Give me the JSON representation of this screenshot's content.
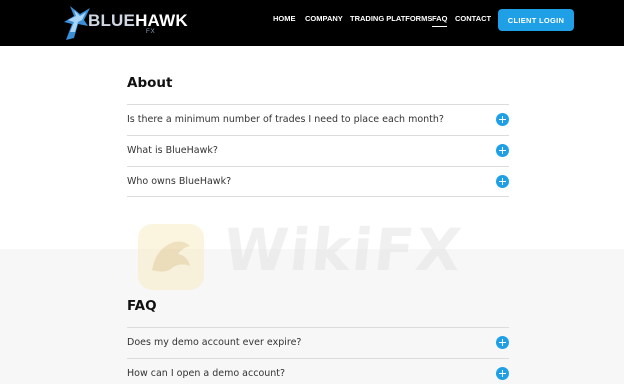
{
  "header": {
    "logo": {
      "word1": "BLUE",
      "word2": "HAWK",
      "suffix": "FX",
      "icon": "hawk-logo-icon"
    },
    "nav": [
      {
        "label": "HOME",
        "active": false
      },
      {
        "label": "COMPANY",
        "active": false
      },
      {
        "label": "TRADING PLATFORMS",
        "active": false
      },
      {
        "label": "FAQ",
        "active": true
      },
      {
        "label": "CONTACT",
        "active": false
      }
    ],
    "login_label": "CLIENT LOGIN"
  },
  "about": {
    "title": "About",
    "items": [
      "Is there a minimum number of trades I need to place each month?",
      "What is BlueHawk?",
      "Who owns BlueHawk?"
    ]
  },
  "faq": {
    "title": "FAQ",
    "items": [
      "Does my demo account ever expire?",
      "How can I open a demo account?"
    ]
  },
  "watermark": {
    "text": "WikiFX",
    "icon": "wikifx-logo-icon"
  },
  "colors": {
    "header_bg": "#000000",
    "accent": "#1fa0e6",
    "grey_section": "#f7f7f7",
    "divider": "#dcdcdc"
  }
}
